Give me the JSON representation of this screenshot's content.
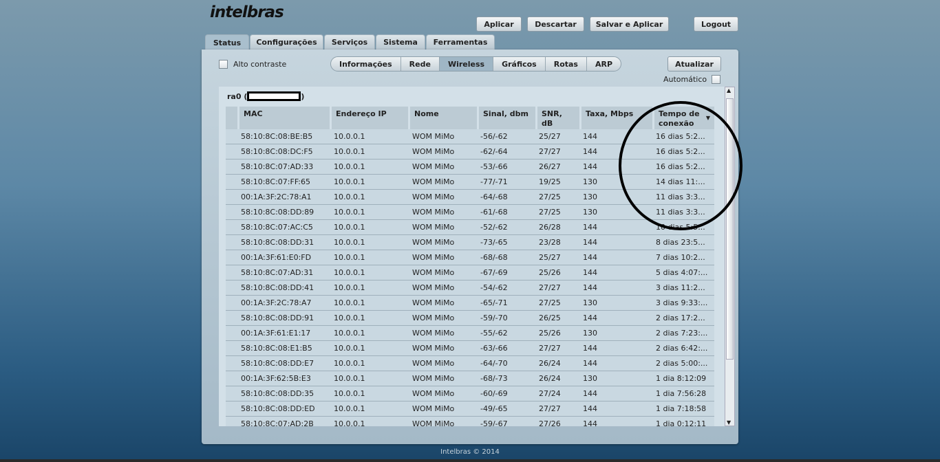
{
  "logo": "intelbras",
  "toolbar": {
    "apply": "Aplicar",
    "discard": "Descartar",
    "save_apply": "Salvar e Aplicar",
    "logout": "Logout"
  },
  "tabs": [
    "Status",
    "Configurações",
    "Serviços",
    "Sistema",
    "Ferramentas"
  ],
  "high_contrast": "Alto contraste",
  "subtabs": [
    "Informações",
    "Rede",
    "Wireless",
    "Gráficos",
    "Rotas",
    "ARP"
  ],
  "refresh": "Atualizar",
  "automatic": "Automático",
  "interface_label": "ra0 (",
  "interface_close": ")",
  "columns": [
    "MAC",
    "Endereço IP",
    "Nome",
    "Sinal, dbm",
    "SNR, dB",
    "Taxa, Mbps",
    "Tempo de conexão"
  ],
  "rows": [
    [
      "58:10:8C:08:BE:B5",
      "10.0.0.1",
      "WOM MiMo",
      "-56/-62",
      "25/27",
      "144",
      "16 dias 5:2..."
    ],
    [
      "58:10:8C:08:DC:F5",
      "10.0.0.1",
      "WOM MiMo",
      "-62/-64",
      "27/27",
      "144",
      "16 dias 5:2..."
    ],
    [
      "58:10:8C:07:AD:33",
      "10.0.0.1",
      "WOM MiMo",
      "-53/-66",
      "26/27",
      "144",
      "16 dias 5:2..."
    ],
    [
      "58:10:8C:07:FF:65",
      "10.0.0.1",
      "WOM MiMo",
      "-77/-71",
      "19/25",
      "130",
      "14 dias 11:..."
    ],
    [
      "00:1A:3F:2C:78:A1",
      "10.0.0.1",
      "WOM MiMo",
      "-64/-68",
      "27/25",
      "130",
      "11 dias 3:3..."
    ],
    [
      "58:10:8C:08:DD:89",
      "10.0.0.1",
      "WOM MiMo",
      "-61/-68",
      "27/25",
      "130",
      "11 dias 3:3..."
    ],
    [
      "58:10:8C:07:AC:C5",
      "10.0.0.1",
      "WOM MiMo",
      "-52/-62",
      "26/28",
      "144",
      "10 dias 5:5..."
    ],
    [
      "58:10:8C:08:DD:31",
      "10.0.0.1",
      "WOM MiMo",
      "-73/-65",
      "23/28",
      "144",
      "8 dias 23:5..."
    ],
    [
      "00:1A:3F:61:E0:FD",
      "10.0.0.1",
      "WOM MiMo",
      "-68/-68",
      "25/27",
      "144",
      "7 dias 10:2..."
    ],
    [
      "58:10:8C:07:AD:31",
      "10.0.0.1",
      "WOM MiMo",
      "-67/-69",
      "25/26",
      "144",
      "5 dias 4:07:..."
    ],
    [
      "58:10:8C:08:DD:41",
      "10.0.0.1",
      "WOM MiMo",
      "-54/-62",
      "27/27",
      "144",
      "3 dias 11:2..."
    ],
    [
      "00:1A:3F:2C:78:A7",
      "10.0.0.1",
      "WOM MiMo",
      "-65/-71",
      "27/25",
      "130",
      "3 dias 9:33:..."
    ],
    [
      "58:10:8C:08:DD:91",
      "10.0.0.1",
      "WOM MiMo",
      "-59/-70",
      "26/25",
      "144",
      "2 dias 17:2..."
    ],
    [
      "00:1A:3F:61:E1:17",
      "10.0.0.1",
      "WOM MiMo",
      "-55/-62",
      "25/26",
      "130",
      "2 dias 7:23:..."
    ],
    [
      "58:10:8C:08:E1:B5",
      "10.0.0.1",
      "WOM MiMo",
      "-63/-66",
      "27/27",
      "144",
      "2 dias 6:42:..."
    ],
    [
      "58:10:8C:08:DD:E7",
      "10.0.0.1",
      "WOM MiMo",
      "-64/-70",
      "26/24",
      "144",
      "2 dias 5:00:..."
    ],
    [
      "00:1A:3F:62:5B:E3",
      "10.0.0.1",
      "WOM MiMo",
      "-68/-73",
      "26/24",
      "130",
      "1 dia 8:12:09"
    ],
    [
      "58:10:8C:08:DD:35",
      "10.0.0.1",
      "WOM MiMo",
      "-60/-69",
      "27/24",
      "144",
      "1 dia 7:56:28"
    ],
    [
      "58:10:8C:08:DD:ED",
      "10.0.0.1",
      "WOM MiMo",
      "-49/-65",
      "27/27",
      "144",
      "1 dia 7:18:58"
    ],
    [
      "58:10:8C:07:AD:2B",
      "10.0.0.1",
      "WOM MiMo",
      "-59/-67",
      "27/26",
      "144",
      "1 dia 0:12:11"
    ]
  ],
  "footer": "Intelbras © 2014"
}
